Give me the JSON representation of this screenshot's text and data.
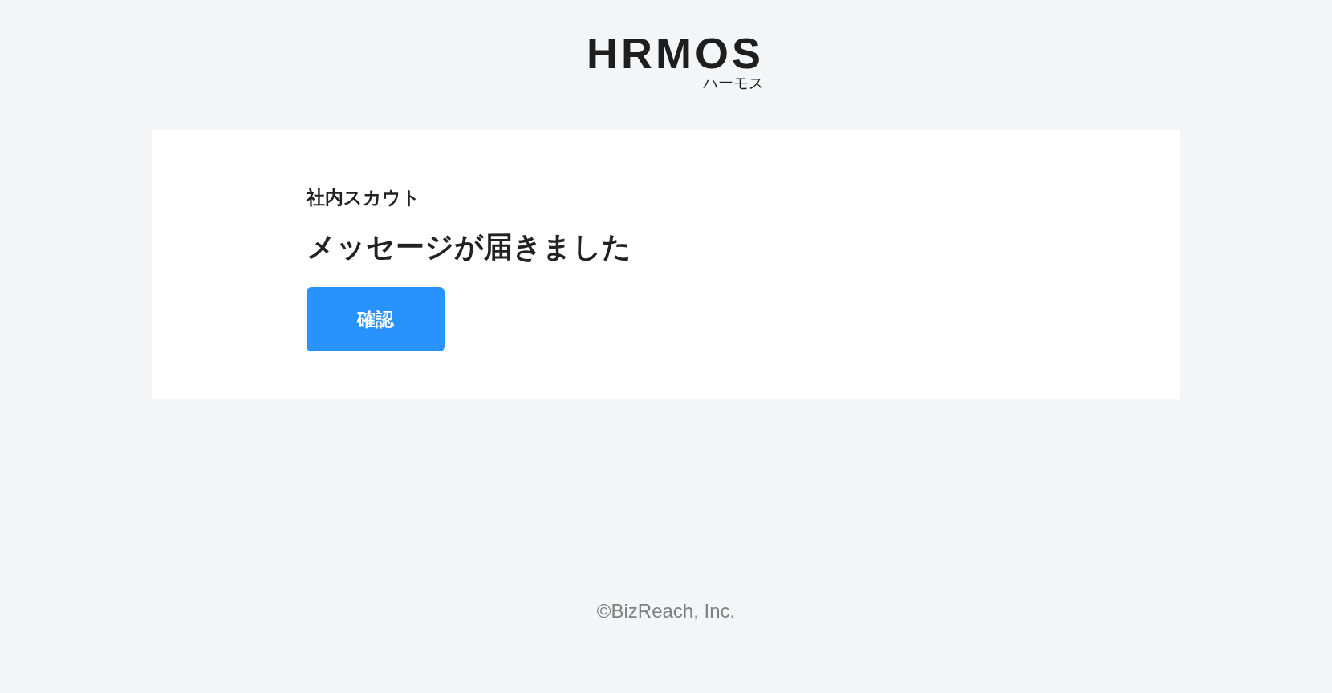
{
  "logo": {
    "wordmark": "HRMOS",
    "reading": "ハーモス"
  },
  "card": {
    "eyebrow": "社内スカウト",
    "heading": "メッセージが届きました",
    "button": "確認"
  },
  "footer": {
    "copyright": "©BizReach, Inc."
  }
}
